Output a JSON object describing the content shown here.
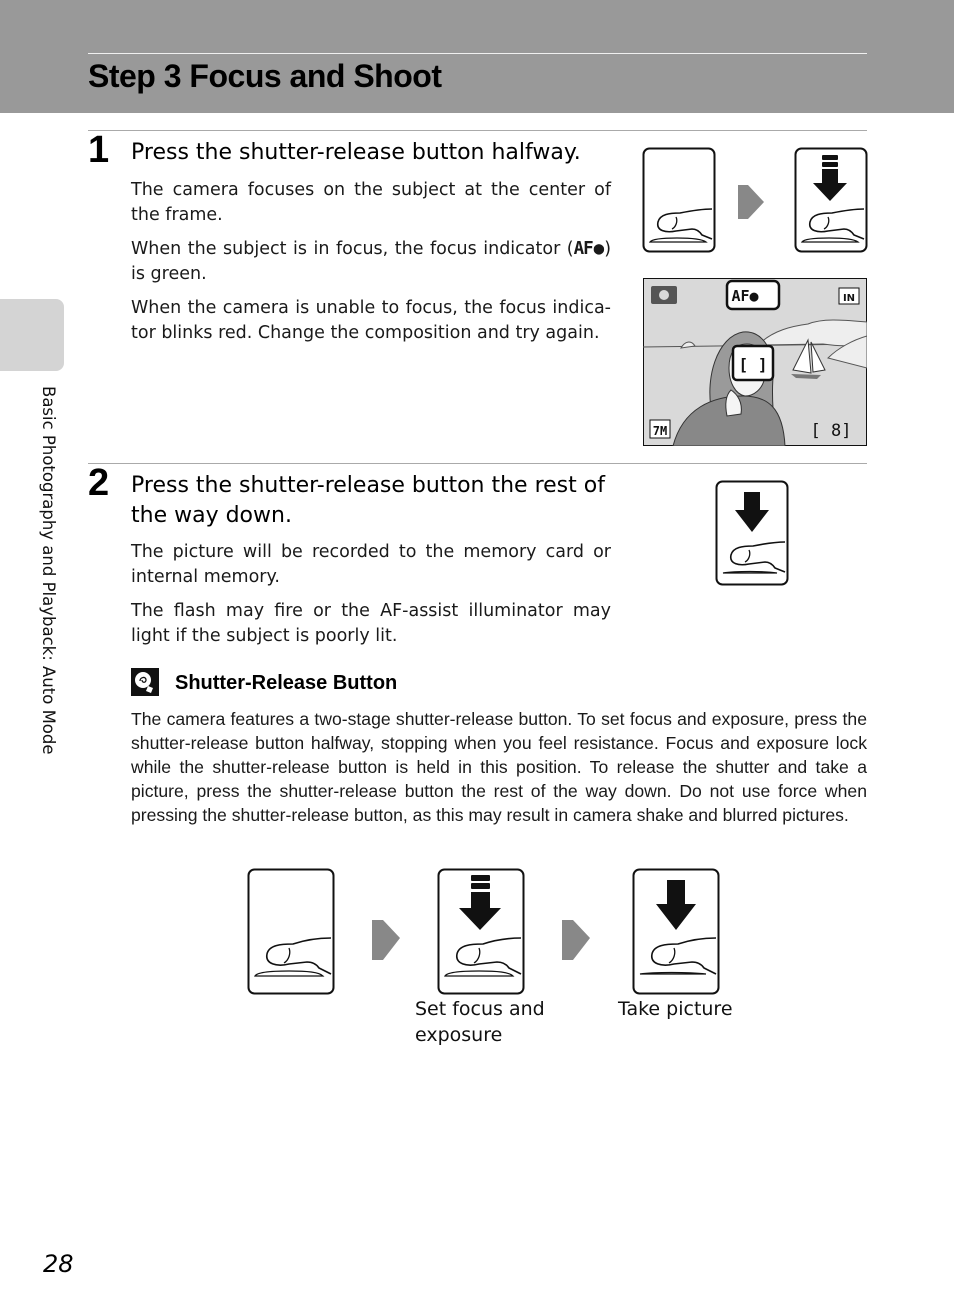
{
  "header": {
    "title": "Step 3 Focus and Shoot"
  },
  "sidebar": {
    "chapter_label": "Basic Photography and Playback: Auto Mode"
  },
  "steps": [
    {
      "number": "1",
      "heading": "Press the shutter-release button halfway.",
      "paragraphs": [
        "The camera focuses on the subject at the center of the frame.",
        "When the subject is in focus, the focus indicator (",
        ") is green.",
        "When the camera is unable to focus, the focus indica-tor blinks red. Change the composition and try again."
      ],
      "focus_indicator_symbol": "AF●",
      "monitor": {
        "mode_icon": "camera-icon",
        "focus_indicator": "AF●",
        "memory_icon": "IN",
        "image_size": "7M",
        "exposures_remaining": "[    8]",
        "focus_area": "[ ]"
      }
    },
    {
      "number": "2",
      "heading": "Press the shutter-release button the rest of the way down.",
      "paragraphs": [
        "The picture will be recorded to the memory card or internal memory.",
        "The flash may fire or the AF-assist illuminator may light if the subject is poorly lit."
      ]
    }
  ],
  "note": {
    "icon": "tip-icon",
    "title": "Shutter-Release Button",
    "body": "The camera features a two-stage shutter-release button. To set focus and exposure, press the shutter-release button halfway, stopping when you feel resistance. Focus and exposure lock while the shutter-release button is held in this position. To release the shutter and take a picture, press the shutter-release button the rest of the way down. Do not use force when pressing the shutter-release button, as this may result in camera shake and blurred pictures."
  },
  "diagram": {
    "captions": [
      "Set focus and exposure",
      "Take picture"
    ]
  },
  "footer": {
    "page_number": "28"
  }
}
